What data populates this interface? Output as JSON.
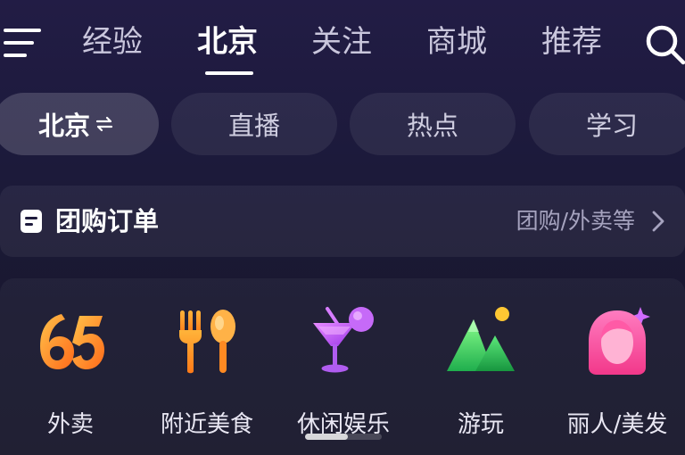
{
  "top_tabs": [
    {
      "label": "经验",
      "active": false
    },
    {
      "label": "北京",
      "active": true
    },
    {
      "label": "关注",
      "active": false
    },
    {
      "label": "商城",
      "active": false
    },
    {
      "label": "推荐",
      "active": false
    }
  ],
  "filters": [
    {
      "label": "北京",
      "active": true,
      "icon": "swap-arrows-icon"
    },
    {
      "label": "直播",
      "active": false
    },
    {
      "label": "热点",
      "active": false
    },
    {
      "label": "学习",
      "active": false
    }
  ],
  "order_card": {
    "title": "团购订单",
    "subtitle": "团购/外卖等",
    "icon": "document-icon"
  },
  "services": [
    {
      "label": "外卖",
      "icon": "takeout-65-icon"
    },
    {
      "label": "附近美食",
      "icon": "fork-spoon-icon"
    },
    {
      "label": "休闲娱乐",
      "icon": "cocktail-icon"
    },
    {
      "label": "游玩",
      "icon": "mountain-sun-icon"
    },
    {
      "label": "丽人/美发",
      "icon": "woman-hair-icon"
    }
  ],
  "carousel": {
    "current_page": 1,
    "total_pages": 2
  },
  "colors": {
    "background": "#1c1a3b",
    "accent_orange": "#ff8a1e",
    "accent_purple": "#b84cf0",
    "accent_green": "#3ed16a",
    "accent_pink": "#ff5aa6"
  }
}
